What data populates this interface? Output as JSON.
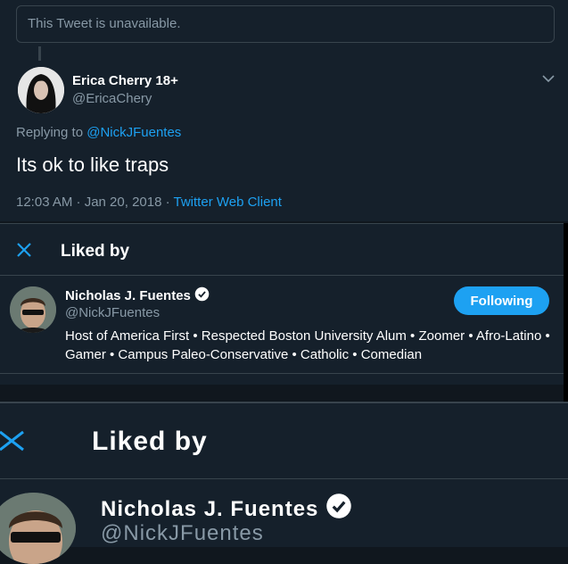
{
  "quoted": {
    "unavailable_text": "This Tweet is unavailable."
  },
  "tweet": {
    "author_name": "Erica Cherry 18+",
    "author_handle": "@EricaChery",
    "replying_prefix": "Replying to ",
    "replying_to": "@NickJFuentes",
    "text": "Its ok to like traps",
    "timestamp": "12:03 AM · Jan 20, 2018 · ",
    "client": "Twitter Web Client"
  },
  "liked_by": {
    "title": "Liked by",
    "user": {
      "name": "Nicholas J. Fuentes",
      "handle": "@NickJFuentes",
      "follow_label": "Following",
      "bio": "Host of America First • Respected Boston University Alum • Zoomer • Afro-Latino • Gamer • Campus Paleo-Conservative • Catholic • Comedian"
    }
  },
  "liked_by_zoom": {
    "title": "Liked by",
    "name": "Nicholas J. Fuentes",
    "handle": "@NickJFuentes"
  },
  "colors": {
    "accent": "#1da1f2",
    "background": "#15202b",
    "muted": "#8899a6",
    "border": "#38444d"
  },
  "icons": [
    "chevron-down-icon",
    "close-icon",
    "verified-icon"
  ]
}
